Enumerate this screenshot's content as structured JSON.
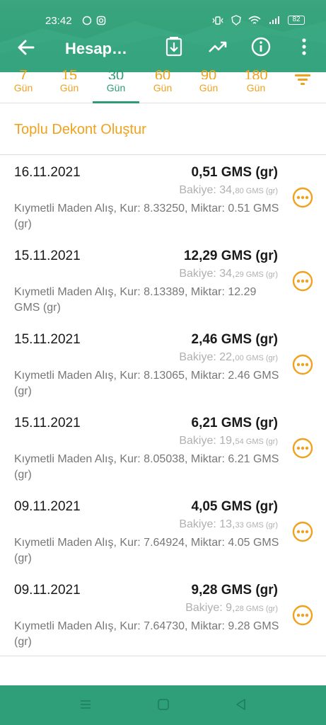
{
  "status_bar": {
    "time": "23:42",
    "battery": "82"
  },
  "toolbar": {
    "title": "Hesap…"
  },
  "periods": [
    {
      "num": "7",
      "label": "Gün",
      "active": false
    },
    {
      "num": "15",
      "label": "Gün",
      "active": false
    },
    {
      "num": "30",
      "label": "Gün",
      "active": true
    },
    {
      "num": "60",
      "label": "Gün",
      "active": false
    },
    {
      "num": "90",
      "label": "Gün",
      "active": false
    },
    {
      "num": "180",
      "label": "Gün",
      "active": false
    }
  ],
  "bulk_receipt_label": "Toplu Dekont Oluştur",
  "transactions": [
    {
      "date": "16.11.2021",
      "amount": "0,51 GMS (gr)",
      "balance_label": "Bakiye:",
      "balance_int": "34,",
      "balance_dec": "80 GMS (gr)",
      "desc": "Kıymetli Maden Alış, Kur: 8.33250, Miktar: 0.51 GMS (gr)"
    },
    {
      "date": "15.11.2021",
      "amount": "12,29 GMS (gr)",
      "balance_label": "Bakiye:",
      "balance_int": "34,",
      "balance_dec": "29 GMS (gr)",
      "desc": "Kıymetli Maden Alış, Kur: 8.13389, Miktar: 12.29 GMS (gr)"
    },
    {
      "date": "15.11.2021",
      "amount": "2,46 GMS (gr)",
      "balance_label": "Bakiye:",
      "balance_int": "22,",
      "balance_dec": "00 GMS (gr)",
      "desc": "Kıymetli Maden Alış, Kur: 8.13065, Miktar: 2.46 GMS (gr)"
    },
    {
      "date": "15.11.2021",
      "amount": "6,21 GMS (gr)",
      "balance_label": "Bakiye:",
      "balance_int": "19,",
      "balance_dec": "54 GMS (gr)",
      "desc": "Kıymetli Maden Alış, Kur: 8.05038, Miktar: 6.21 GMS (gr)"
    },
    {
      "date": "09.11.2021",
      "amount": "4,05 GMS (gr)",
      "balance_label": "Bakiye:",
      "balance_int": "13,",
      "balance_dec": "33 GMS (gr)",
      "desc": "Kıymetli Maden Alış, Kur: 7.64924, Miktar: 4.05 GMS (gr)"
    },
    {
      "date": "09.11.2021",
      "amount": "9,28 GMS (gr)",
      "balance_label": "Bakiye:",
      "balance_int": "9,",
      "balance_dec": "28 GMS (gr)",
      "desc": "Kıymetli Maden Alış, Kur: 7.64730, Miktar: 9.28 GMS (gr)"
    }
  ],
  "icons": {
    "back": "arrow-left-icon",
    "document": "document-download-icon",
    "chart": "trending-up-icon",
    "info": "info-icon",
    "menu": "more-vertical-icon",
    "filter": "filter-icon",
    "more": "more-horizontal-circle-icon"
  },
  "colors": {
    "primary": "#2f9f7a",
    "accent": "#f0a21d"
  }
}
